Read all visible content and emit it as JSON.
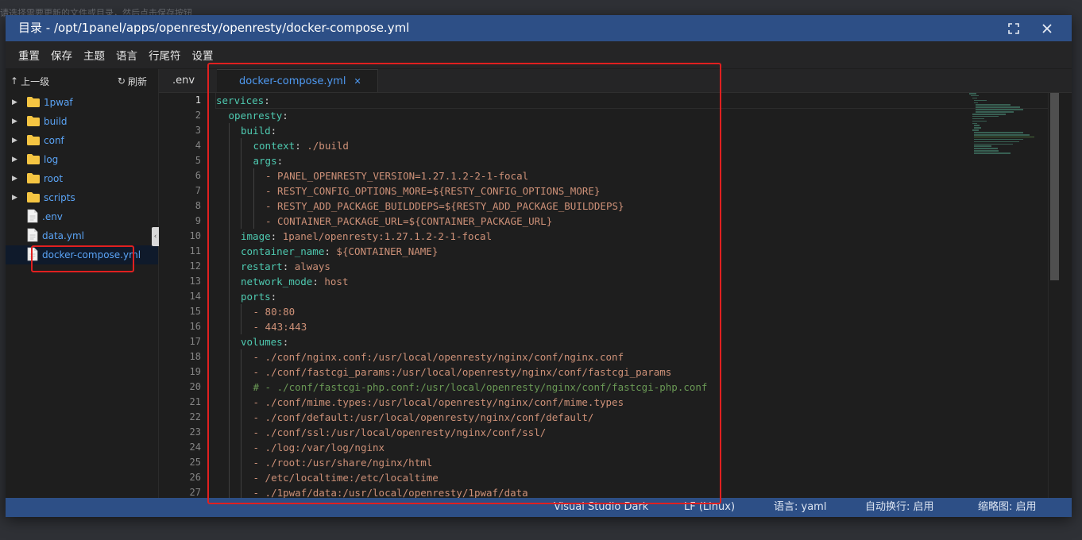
{
  "background_text": "请选择需要更新的文件或目录，然后点击保存按钮",
  "window": {
    "title": "目录 - /opt/1panel/apps/openresty/openresty/docker-compose.yml"
  },
  "menu": {
    "items": [
      "重置",
      "保存",
      "主题",
      "语言",
      "行尾符",
      "设置"
    ]
  },
  "explorer": {
    "up_label": "上一级",
    "refresh_label": "刷新",
    "items": [
      {
        "name": "1pwaf",
        "type": "folder"
      },
      {
        "name": "build",
        "type": "folder"
      },
      {
        "name": "conf",
        "type": "folder"
      },
      {
        "name": "log",
        "type": "folder"
      },
      {
        "name": "root",
        "type": "folder"
      },
      {
        "name": "scripts",
        "type": "folder"
      },
      {
        "name": ".env",
        "type": "file"
      },
      {
        "name": "data.yml",
        "type": "file"
      },
      {
        "name": "docker-compose.yml",
        "type": "file"
      }
    ]
  },
  "tabs": {
    "env": ".env",
    "active": "docker-compose.yml"
  },
  "editor": {
    "line_numbers": [
      "1",
      "2",
      "3",
      "4",
      "5",
      "6",
      "7",
      "8",
      "9",
      "10",
      "11",
      "12",
      "13",
      "14",
      "15",
      "16",
      "17",
      "18",
      "19",
      "20",
      "21",
      "22",
      "23",
      "24",
      "25",
      "26",
      "27"
    ],
    "lines": [
      {
        "indent": 0,
        "key": "services",
        "sep": ":",
        "value": ""
      },
      {
        "indent": 1,
        "key": "openresty",
        "sep": ":",
        "value": ""
      },
      {
        "indent": 2,
        "key": "build",
        "sep": ":",
        "value": ""
      },
      {
        "indent": 3,
        "key": "context",
        "sep": ": ",
        "value": "./build"
      },
      {
        "indent": 3,
        "key": "args",
        "sep": ":",
        "value": ""
      },
      {
        "indent": 4,
        "key": "",
        "sep": "",
        "value": "- PANEL_OPENRESTY_VERSION=1.27.1.2-2-1-focal"
      },
      {
        "indent": 4,
        "key": "",
        "sep": "",
        "value": "- RESTY_CONFIG_OPTIONS_MORE=${RESTY_CONFIG_OPTIONS_MORE}"
      },
      {
        "indent": 4,
        "key": "",
        "sep": "",
        "value": "- RESTY_ADD_PACKAGE_BUILDDEPS=${RESTY_ADD_PACKAGE_BUILDDEPS}"
      },
      {
        "indent": 4,
        "key": "",
        "sep": "",
        "value": "- CONTAINER_PACKAGE_URL=${CONTAINER_PACKAGE_URL}"
      },
      {
        "indent": 2,
        "key": "image",
        "sep": ": ",
        "value": "1panel/openresty:1.27.1.2-2-1-focal"
      },
      {
        "indent": 2,
        "key": "container_name",
        "sep": ": ",
        "value": "${CONTAINER_NAME}"
      },
      {
        "indent": 2,
        "key": "restart",
        "sep": ": ",
        "value": "always"
      },
      {
        "indent": 2,
        "key": "network_mode",
        "sep": ": ",
        "value": "host"
      },
      {
        "indent": 2,
        "key": "ports",
        "sep": ":",
        "value": ""
      },
      {
        "indent": 3,
        "key": "",
        "sep": "",
        "value": "- 80:80"
      },
      {
        "indent": 3,
        "key": "",
        "sep": "",
        "value": "- 443:443"
      },
      {
        "indent": 2,
        "key": "volumes",
        "sep": ":",
        "value": ""
      },
      {
        "indent": 3,
        "key": "",
        "sep": "",
        "value": "- ./conf/nginx.conf:/usr/local/openresty/nginx/conf/nginx.conf"
      },
      {
        "indent": 3,
        "key": "",
        "sep": "",
        "value": "- ./conf/fastcgi_params:/usr/local/openresty/nginx/conf/fastcgi_params"
      },
      {
        "indent": 3,
        "key": "",
        "sep": "",
        "value": "# - ./conf/fastcgi-php.conf:/usr/local/openresty/nginx/conf/fastcgi-php.conf",
        "comment": true
      },
      {
        "indent": 3,
        "key": "",
        "sep": "",
        "value": "- ./conf/mime.types:/usr/local/openresty/nginx/conf/mime.types"
      },
      {
        "indent": 3,
        "key": "",
        "sep": "",
        "value": "- ./conf/default:/usr/local/openresty/nginx/conf/default/"
      },
      {
        "indent": 3,
        "key": "",
        "sep": "",
        "value": "- ./conf/ssl:/usr/local/openresty/nginx/conf/ssl/"
      },
      {
        "indent": 3,
        "key": "",
        "sep": "",
        "value": "- ./log:/var/log/nginx"
      },
      {
        "indent": 3,
        "key": "",
        "sep": "",
        "value": "- ./root:/usr/share/nginx/html"
      },
      {
        "indent": 3,
        "key": "",
        "sep": "",
        "value": "- /etc/localtime:/etc/localtime"
      },
      {
        "indent": 3,
        "key": "",
        "sep": "",
        "value": "- ./1pwaf/data:/usr/local/openresty/1pwaf/data"
      }
    ]
  },
  "status": {
    "theme": "Visual Studio Dark",
    "eol": "LF (Linux)",
    "language": "语言: yaml",
    "wrap": "自动换行: 启用",
    "minimap": "缩略图: 启用"
  },
  "colors": {
    "titlebar": "#2d4f86",
    "key": "#4ec9b0",
    "string": "#ce9178",
    "comment": "#6a9955",
    "link": "#5aa3f5",
    "highlight": "#e02020"
  }
}
